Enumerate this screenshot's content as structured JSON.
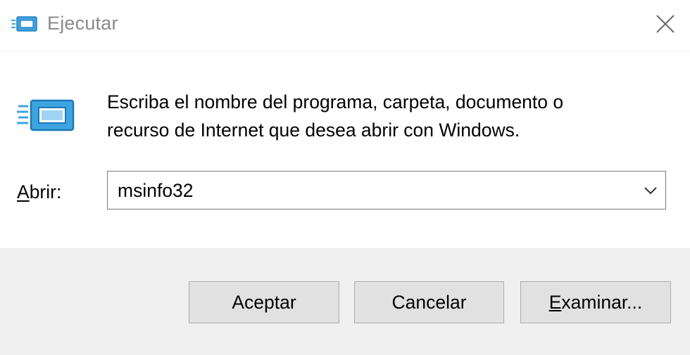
{
  "window": {
    "title": "Ejecutar",
    "icon": "run-icon",
    "close_icon": "close-icon"
  },
  "prompt": {
    "line1": "Escriba el nombre del programa, carpeta, documento o",
    "line2": "recurso de Internet que desea abrir con Windows."
  },
  "open_field": {
    "label_accel": "A",
    "label_rest": "brir:",
    "value": "msinfo32",
    "dropdown_icon": "chevron-down-icon"
  },
  "buttons": {
    "accept": "Aceptar",
    "cancel": "Cancelar",
    "browse_accel": "E",
    "browse_rest": "xaminar..."
  },
  "colors": {
    "icon_blue": "#2f9ad8",
    "title_gray": "#8a8a8a",
    "footer_bg": "#f0f0f0",
    "button_bg": "#e1e1e1",
    "button_border": "#adadad"
  }
}
